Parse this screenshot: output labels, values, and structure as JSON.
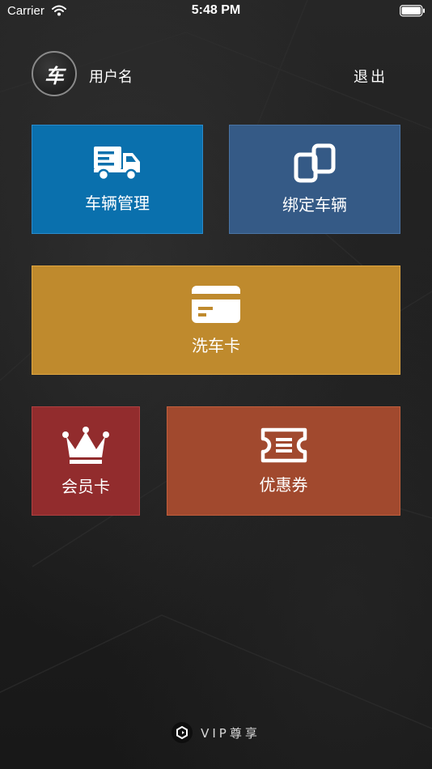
{
  "status_bar": {
    "carrier": "Carrier",
    "time": "5:48 PM"
  },
  "header": {
    "avatar_text": "车",
    "username": "用户名",
    "logout": "退出"
  },
  "tiles": {
    "vehicle_management": {
      "label": "车辆管理",
      "icon": "truck-icon",
      "color": "#0a70ad"
    },
    "bind_vehicle": {
      "label": "绑定车辆",
      "icon": "link-icon",
      "color": "#355a86"
    },
    "wash_card": {
      "label": "洗车卡",
      "icon": "card-icon",
      "color": "#bf8a2d"
    },
    "member_card": {
      "label": "会员卡",
      "icon": "crown-icon",
      "color": "#922c2d"
    },
    "coupon": {
      "label": "优惠券",
      "icon": "ticket-icon",
      "color": "#a1492e"
    }
  },
  "footer": {
    "text": "VIP尊享"
  }
}
